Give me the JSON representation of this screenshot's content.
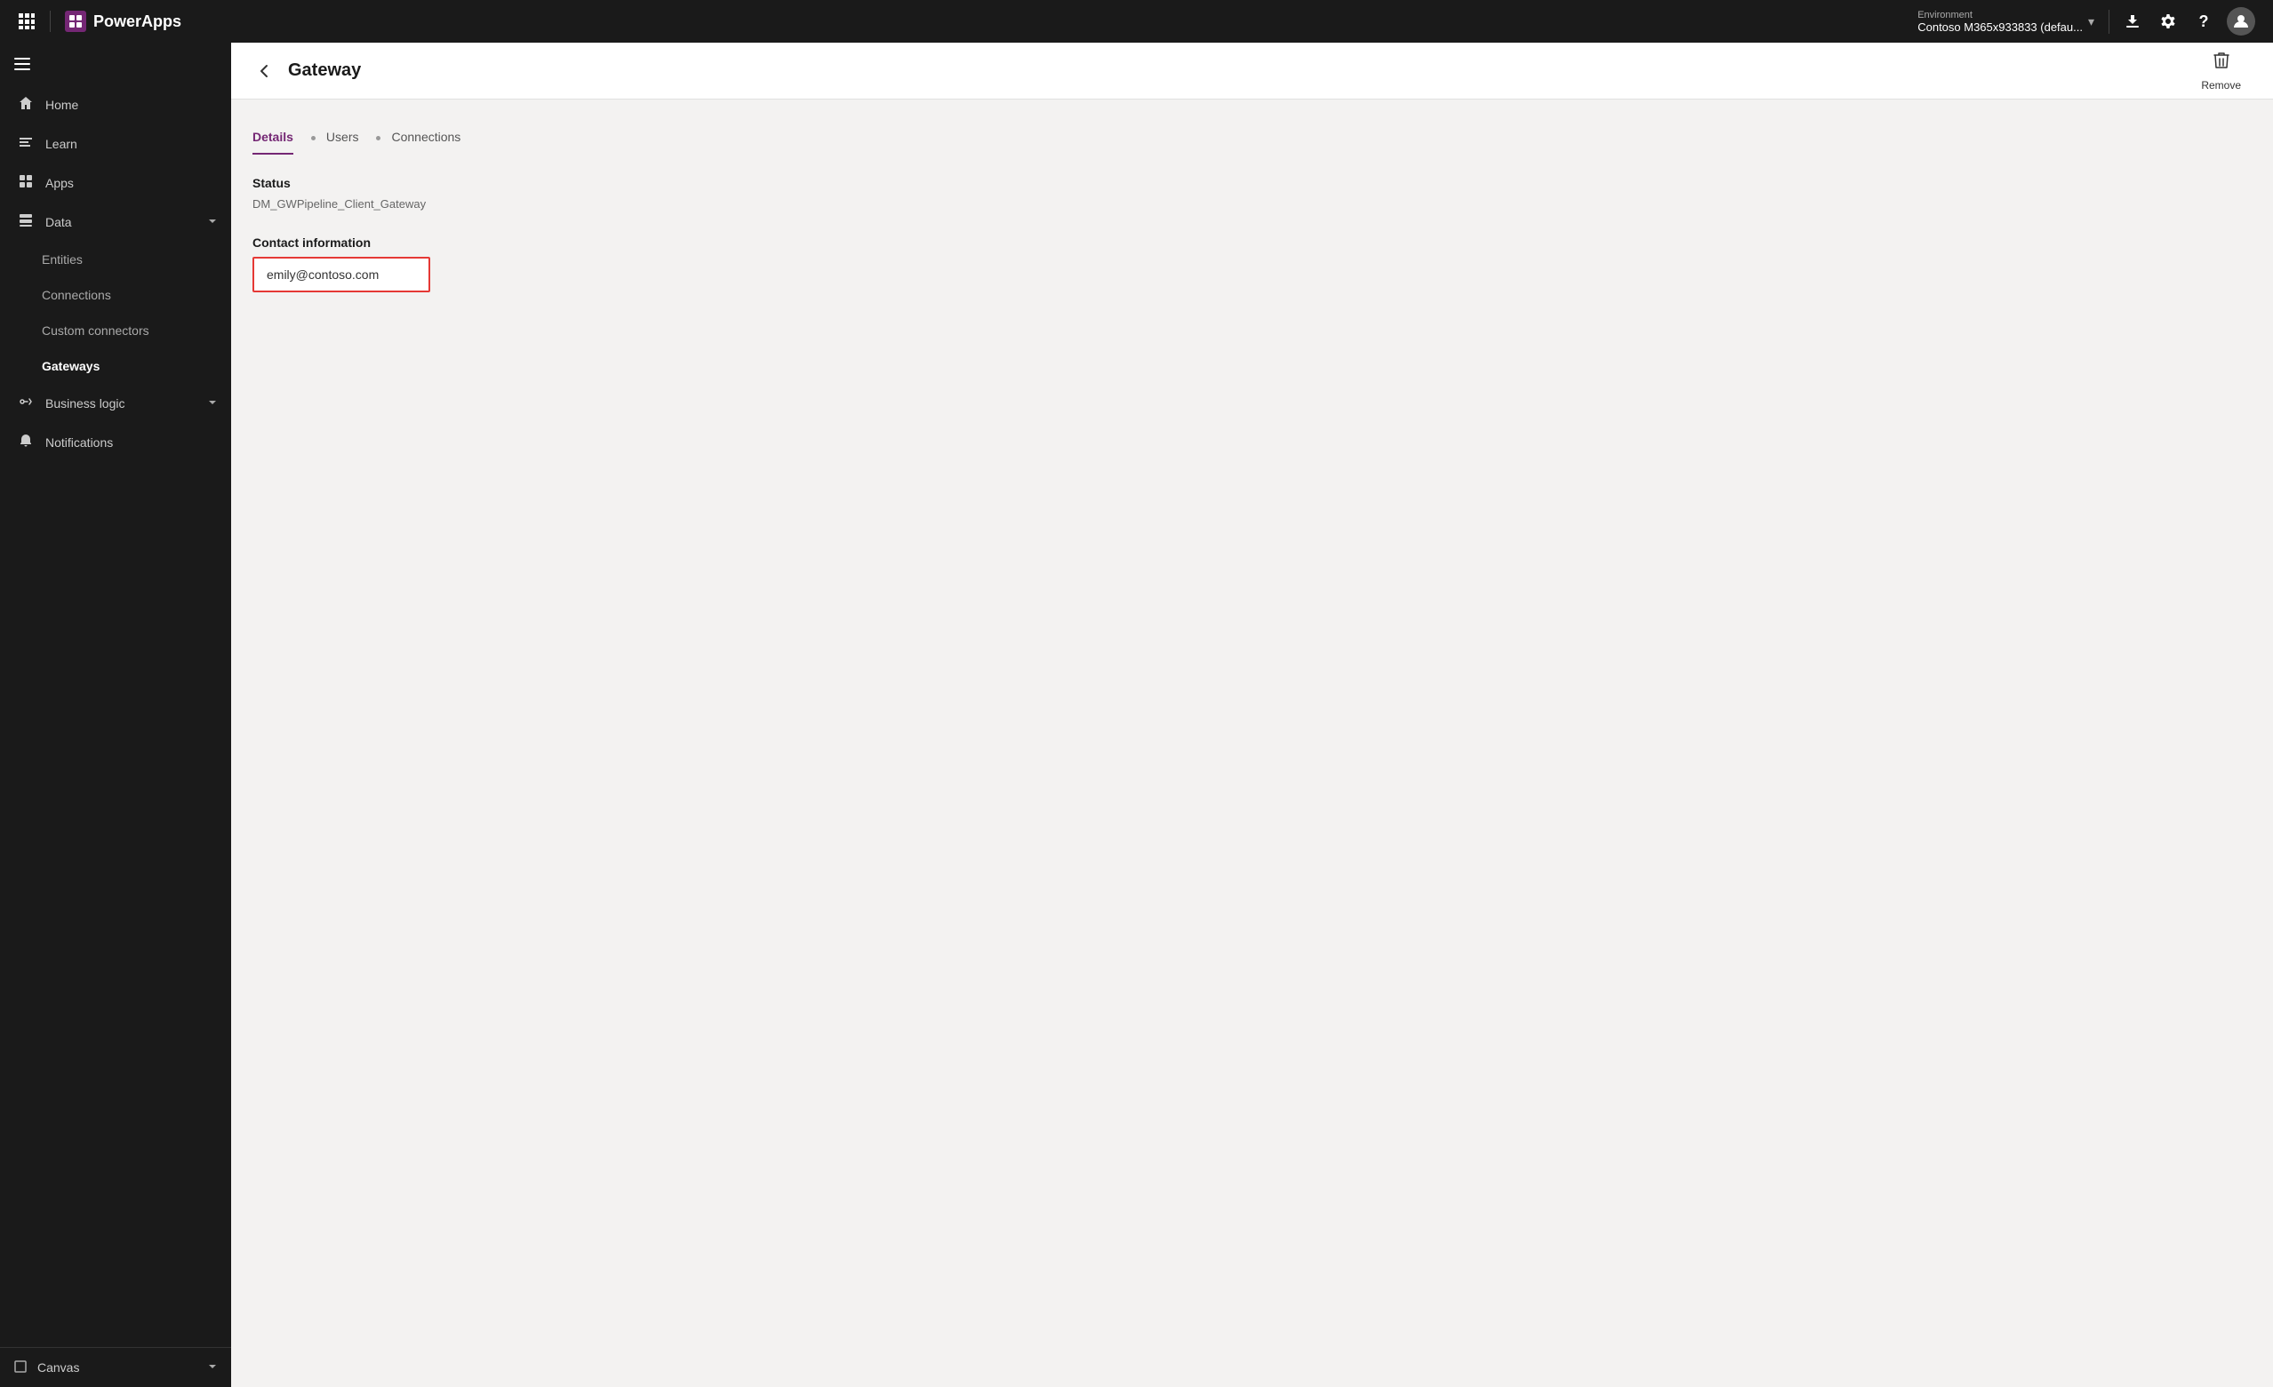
{
  "topbar": {
    "app_name": "PowerApps",
    "environment_label": "Environment",
    "environment_name": "Contoso M365x933833 (defau...",
    "download_icon": "⬇",
    "settings_icon": "⚙",
    "help_icon": "?",
    "avatar_text": "👤",
    "waffle_icon": "⊞"
  },
  "sidebar": {
    "menu_icon": "☰",
    "items": [
      {
        "id": "home",
        "label": "Home",
        "icon": "🏠",
        "active": false
      },
      {
        "id": "learn",
        "label": "Learn",
        "icon": "📖",
        "active": false
      },
      {
        "id": "apps",
        "label": "Apps",
        "icon": "⊞",
        "active": false
      },
      {
        "id": "data",
        "label": "Data",
        "icon": "🗃",
        "active": false,
        "expanded": true
      }
    ],
    "data_subitems": [
      {
        "id": "entities",
        "label": "Entities",
        "active": false
      },
      {
        "id": "connections",
        "label": "Connections",
        "active": false
      },
      {
        "id": "custom-connectors",
        "label": "Custom connectors",
        "active": false
      },
      {
        "id": "gateways",
        "label": "Gateways",
        "active": true
      }
    ],
    "bottom_items": [
      {
        "id": "business-logic",
        "label": "Business logic",
        "icon": "⚙",
        "active": false
      },
      {
        "id": "notifications",
        "label": "Notifications",
        "icon": "🔔",
        "active": false
      }
    ],
    "canvas_item": {
      "label": "Canvas",
      "icon": "◻"
    }
  },
  "page": {
    "back_label": "←",
    "title": "Gateway",
    "remove_label": "Remove"
  },
  "tabs": [
    {
      "id": "details",
      "label": "Details",
      "active": true
    },
    {
      "id": "users",
      "label": "Users",
      "active": false
    },
    {
      "id": "connections",
      "label": "Connections",
      "active": false
    }
  ],
  "gateway_details": {
    "status_label": "Status",
    "gateway_name": "DM_GWPipeline_Client_Gateway",
    "contact_section_label": "Contact information",
    "contact_email": "emily@contoso.com",
    "contact_placeholder": "emily@contoso.com"
  }
}
